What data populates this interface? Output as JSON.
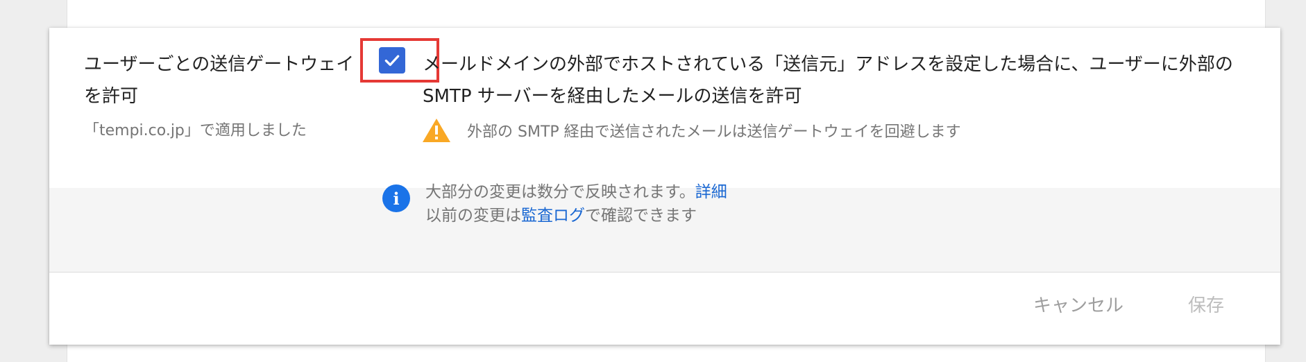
{
  "setting": {
    "title": "ユーザーごとの送信ゲートウェイを許可",
    "applied_note": "「tempi.co.jp」で適用しました",
    "checkbox_checked": true,
    "description": "メールドメインの外部でホストされている「送信元」アドレスを設定した場合に、ユーザーに外部の SMTP サーバーを経由したメールの送信を許可",
    "warning": "外部の SMTP 経由で送信されたメールは送信ゲートウェイを回避します"
  },
  "info": {
    "line1": "大部分の変更は数分で反映されます。",
    "line1_link": "詳細",
    "line2_prefix": "以前の変更は",
    "line2_link": "監査ログ",
    "line2_suffix": "で確認できます"
  },
  "footer": {
    "cancel": "キャンセル",
    "save": "保存"
  },
  "colors": {
    "accent": "#3367d6",
    "warning": "#f9a825",
    "highlight": "#e53935",
    "link": "#1967d2"
  }
}
